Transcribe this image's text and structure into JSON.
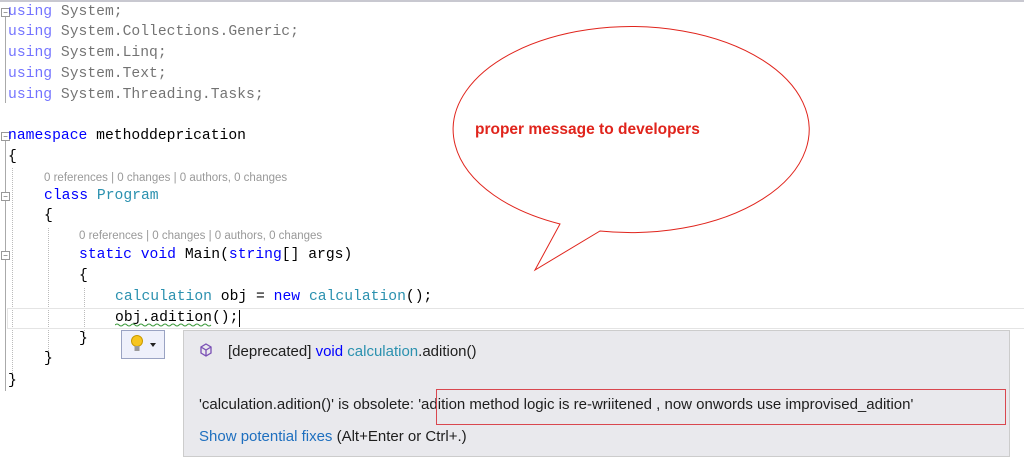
{
  "code": {
    "usings": [
      "System;",
      "System.Collections.Generic;",
      "System.Linq;",
      "System.Text;",
      "System.Threading.Tasks;"
    ],
    "using_kw": "using",
    "namespace_kw": "namespace",
    "namespace_name": "methoddeprication",
    "open_brace": "{",
    "close_brace": "}",
    "codelens_class": "0 references | 0 changes | 0 authors, 0 changes",
    "codelens_main": "0 references | 0 changes | 0 authors, 0 changes",
    "class_kw": "class",
    "class_name": "Program",
    "static_kw": "static",
    "void_kw": "void",
    "main_sig_a": "Main(",
    "string_kw": "string",
    "main_sig_b": "[] args)",
    "decl_type": "calculation",
    "decl_mid": " obj = ",
    "new_kw": "new",
    "decl_type2": "calculation",
    "decl_end": "();",
    "call_line": "obj.adition();"
  },
  "callout": {
    "text": "proper message to developers",
    "color": "#e0241c"
  },
  "quick_actions": {
    "icon": "lightbulb-icon"
  },
  "tooltip": {
    "sig_prefix": "[deprecated] ",
    "sig_void": "void",
    "sig_class": "calculation",
    "sig_method": ".adition()",
    "obsolete_prefix": "'calculation.adition()' is obsolete: ",
    "obsolete_message": "'adition method logic is re-wriitened , now onwords use improvised_adition'",
    "fix_link": "Show potential fixes",
    "fix_shortcut": " (Alt+Enter or Ctrl+.)"
  }
}
